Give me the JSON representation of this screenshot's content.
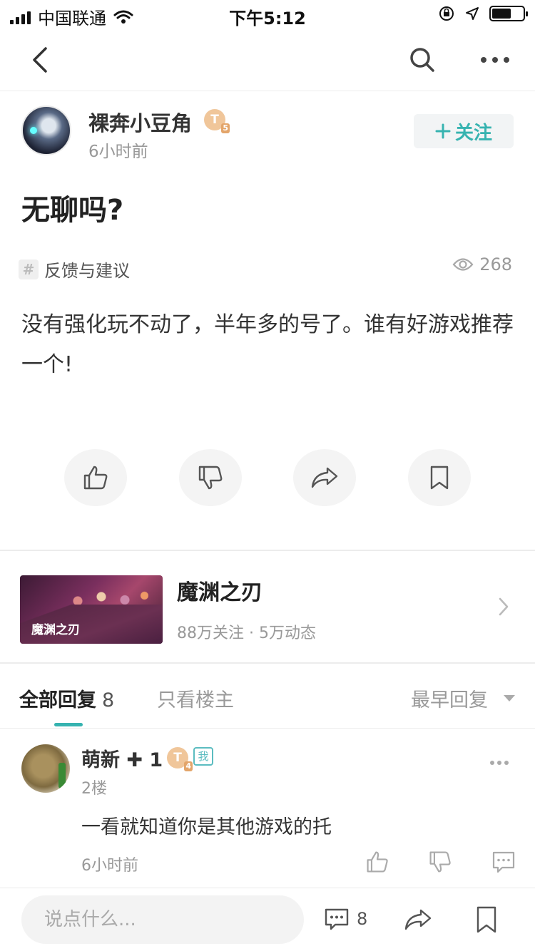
{
  "status_bar": {
    "carrier": "中国联通",
    "time": "下午5:12",
    "battery_level": 0.62
  },
  "nav": {
    "back_icon": "chevron-left-icon",
    "search_icon": "search-icon",
    "more_icon": "more-horizontal-icon"
  },
  "post": {
    "author": {
      "name": "裸奔小豆角",
      "level_badge": "T",
      "level_num": "5",
      "time": "6小时前"
    },
    "follow_label": "关注",
    "title": "无聊吗?",
    "tag_icon": "#",
    "tag": "反馈与建议",
    "views": "268",
    "body": "没有强化玩不动了，半年多的号了。谁有好游戏推荐一个!",
    "actions": [
      "like-icon",
      "dislike-icon",
      "share-icon",
      "bookmark-icon"
    ]
  },
  "game": {
    "name": "魔渊之刃",
    "logo_text": "魔渊之刃",
    "stats": "88万关注 · 5万动态"
  },
  "replies_header": {
    "all_label": "全部回复",
    "all_count": "8",
    "op_only_label": "只看楼主",
    "sort_label": "最早回复"
  },
  "replies": [
    {
      "name": "萌新",
      "plus_one": "✚ 1",
      "level_badge": "T",
      "level_num": "4",
      "me_badge": "我",
      "floor": "2楼",
      "text": "一看就知道你是其他游戏的托",
      "time": "6小时前"
    }
  ],
  "bottom_bar": {
    "placeholder": "说点什么...",
    "comment_count": "8"
  },
  "colors": {
    "accent": "#36b3b0",
    "muted": "#999999",
    "badge": "#f0c69a"
  }
}
